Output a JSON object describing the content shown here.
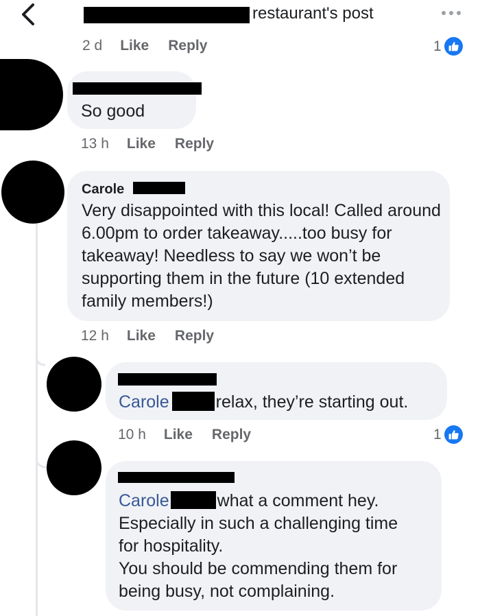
{
  "header": {
    "title": "restaurant's post",
    "back_icon": "back-chevron-icon",
    "more_icon": "more-horizontal-icon"
  },
  "top_comment_actions": {
    "time": "2 d",
    "like": "Like",
    "reply": "Reply",
    "like_count": "1"
  },
  "comment_1": {
    "text": "So good",
    "actions": {
      "time": "13 h",
      "like": "Like",
      "reply": "Reply"
    }
  },
  "comment_2": {
    "author": "Carole",
    "text": "Very disappointed with this local! Called around 6.00pm to order takeaway.....too busy for takeaway! Needless to say we won’t be supporting them in the future (10 extended family members!)",
    "actions": {
      "time": "12 h",
      "like": "Like",
      "reply": "Reply"
    }
  },
  "reply_1": {
    "mention": "Carole",
    "text": "relax, they’re starting out.",
    "actions": {
      "time": "10 h",
      "like": "Like",
      "reply": "Reply",
      "like_count": "1"
    }
  },
  "reply_2": {
    "mention": "Carole",
    "line1": "what a comment hey.",
    "line2": "Especially in such a challenging time",
    "line3": "for hospitality.",
    "line4": "You should be commending them for",
    "line5": "being busy, not complaining."
  },
  "colors": {
    "bubble": "#f0f2f5",
    "mention": "#385898",
    "like_badge": "#1877f2",
    "secondary_text": "#65676b",
    "redaction": "#000000"
  }
}
